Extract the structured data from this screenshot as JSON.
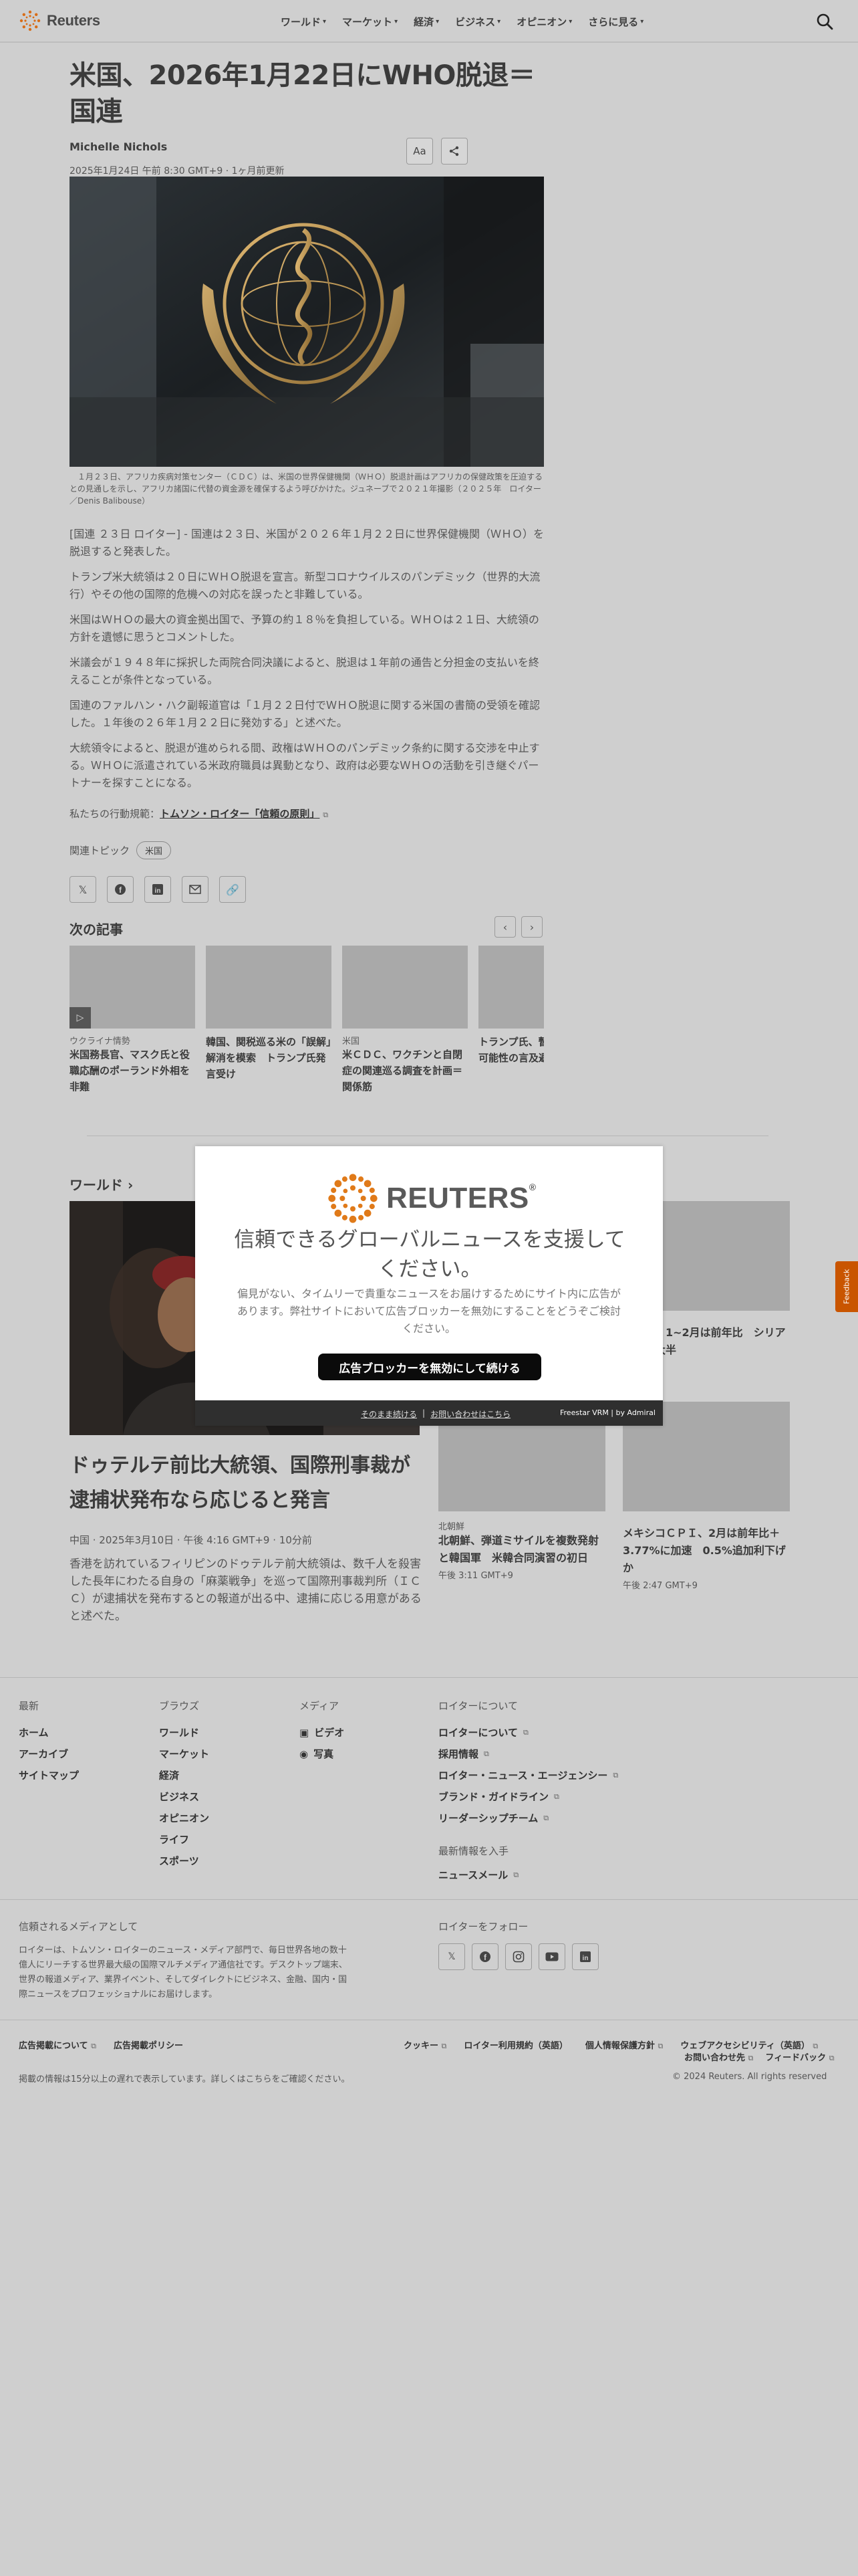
{
  "header": {
    "brand": "Reuters",
    "nav": [
      "ワールド",
      "マーケット",
      "経済",
      "ビジネス",
      "オピニオン",
      "さらに見る"
    ]
  },
  "article": {
    "headline": "米国、2026年1月22日にWHO脱退＝国連",
    "author": "Michelle Nichols",
    "dateline": "2025年1月24日 午前 8:30 GMT+9 · 1ヶ月前更新",
    "text_size_label": "Aa",
    "caption": "　１月２３日、アフリカ疾病対策センター（ＣＤＣ）は、米国の世界保健機関（ＷＨＯ）脱退計画はアフリカの保健政策を圧迫するとの見通しを示し、アフリカ諸国に代替の資金源を確保するよう呼びかけた。ジュネーブで２０２１年撮影（２０２５年　ロイター／Denis Balibouse）",
    "paragraphs": [
      "[国連 ２３日 ロイター] - 国連は２３日、米国が２０２６年１月２２日に世界保健機関（ＷＨＯ）を脱退すると発表した。",
      "トランプ米大統領は２０日にＷＨＯ脱退を宣言。新型コロナウイルスのパンデミック（世界的大流行）やその他の国際的危機への対応を誤ったと非難している。",
      "米国はＷＨＯの最大の資金拠出国で、予算の約１８％を負担している。ＷＨＯは２１日、大統領の方針を遺憾に思うとコメントした。",
      "米議会が１９４８年に採択した両院合同決議によると、脱退は１年前の通告と分担金の支払いを終えることが条件となっている。",
      "国連のファルハン・ハク副報道官は「１月２２日付でＷＨＯ脱退に関する米国の書簡の受領を確認した。１年後の２６年１月２２日に発効する」と述べた。",
      "大統領令によると、脱退が進められる間、政権はＷＨＯのパンデミック条約に関する交渉を中止する。ＷＨＯに派遣されている米政府職員は異動となり、政府は必要なＷＨＯの活動を引き継ぐパートナーを探すことになる。"
    ],
    "principles_prefix": "私たちの行動規範：",
    "principles_link": "トムソン・ロイター「信頼の原則」",
    "topics_label": "関連トピック",
    "topic_chip": "米国"
  },
  "next_articles": {
    "title": "次の記事",
    "cards": [
      {
        "category": "ウクライナ情勢",
        "title": "米国務長官、マスク氏と役職応酬のポーランド外相を非難"
      },
      {
        "category": "",
        "title": "韓国、関税巡る米の「誤解」解消を模索　トランプ氏発言受け"
      },
      {
        "category": "米国",
        "title": "米ＣＤＣ、ワクチンと自閉症の関連巡る調査を計画＝関係筋"
      },
      {
        "category": "",
        "title": "トランプ氏、暫定気候法の可能性の言及避ける"
      }
    ]
  },
  "world": {
    "title": "ワールド",
    "main": {
      "title": "ドゥテルテ前比大統領、国際刑事裁が逮捕状発布なら応じると発言",
      "meta": "中国 · 2025年3月10日 · 午後 4:16 GMT+9 · 10分前",
      "desc": "香港を訪れているフィリピンのドゥテルテ前大統領は、数千人を殺害した長年にわたる自身の「麻薬戦争」を巡って国際刑事裁判所（ＩＣＣ）が逮捕状を発布するとの報道が出る中、逮捕に応じる用意があると述べた。"
    },
    "cards": [
      {
        "category": "",
        "title": "民申請、1~2月は前年比　シリアからが大半",
        "time": "GMT+9"
      },
      {
        "category": "北朝鮮",
        "title": "北朝鮮、弾道ミサイルを複数発射と韓国軍　米韓合同演習の初日",
        "time": "午後 3:11 GMT+9"
      },
      {
        "category": "",
        "title": "メキシコＣＰＩ、2月は前年比＋3.77%に加速　0.5%追加利下げか",
        "time": "午後 2:47 GMT+9"
      }
    ]
  },
  "modal": {
    "brand": "REUTERS",
    "heading": "信頼できるグローバルニュースを支援してください。",
    "desc": "偏見がない、タイムリーで貴重なニュースをお届けするためにサイト内に広告があります。弊社サイトにおいて広告ブロッカーを無効にすることをどうぞご検討ください。",
    "button": "広告ブロッカーを無効にして続ける",
    "continue_link": "そのまま続ける",
    "separator": "|",
    "contact_link": "お問い合わせはこちら",
    "powered": "Freestar VRM  |  by Admiral"
  },
  "feedback": "Feedback",
  "footer": {
    "col1": {
      "title": "最新",
      "items": [
        "ホーム",
        "アーカイブ",
        "サイトマップ"
      ]
    },
    "col2": {
      "title": "ブラウズ",
      "items": [
        "ワールド",
        "マーケット",
        "経済",
        "ビジネス",
        "オピニオン",
        "ライフ",
        "スポーツ"
      ]
    },
    "col3": {
      "title": "メディア",
      "items": [
        "ビデオ",
        "写真"
      ]
    },
    "col4": {
      "title": "ロイターについて",
      "items": [
        "ロイターについて",
        "採用情報",
        "ロイター・ニュース・エージェンシー",
        "ブランド・ガイドライン",
        "リーダーシップチーム"
      ],
      "sub_title": "最新情報を入手",
      "sub_item": "ニュースメール"
    },
    "trusted_title": "信頼されるメディアとして",
    "trusted_desc": "ロイターは、トムソン・ロイターのニュース・メディア部門で、毎日世界各地の数十億人にリーチする世界最大級の国際マルチメディア通信社です。デスクトップ端末、世界の報道メディア、業界イベント、そしてダイレクトにビジネス、金融、国内・国際ニュースをプロフェッショナルにお届けします。",
    "follow_title": "ロイターをフォロー",
    "legal_left": [
      "広告掲載について",
      "広告掲載ポリシー"
    ],
    "legal_right": [
      "クッキー",
      "ロイター利用規約（英語）",
      "個人情報保護方針",
      "ウェブアクセシビリティ（英語）"
    ],
    "legal_right2": [
      "お問い合わせ先",
      "フィードバック"
    ],
    "disclaimer": "掲載の情報は15分以上の遅れで表示しています。詳しくはこちらをご確認ください。",
    "copyright": "© 2024 Reuters. All rights reserved"
  }
}
